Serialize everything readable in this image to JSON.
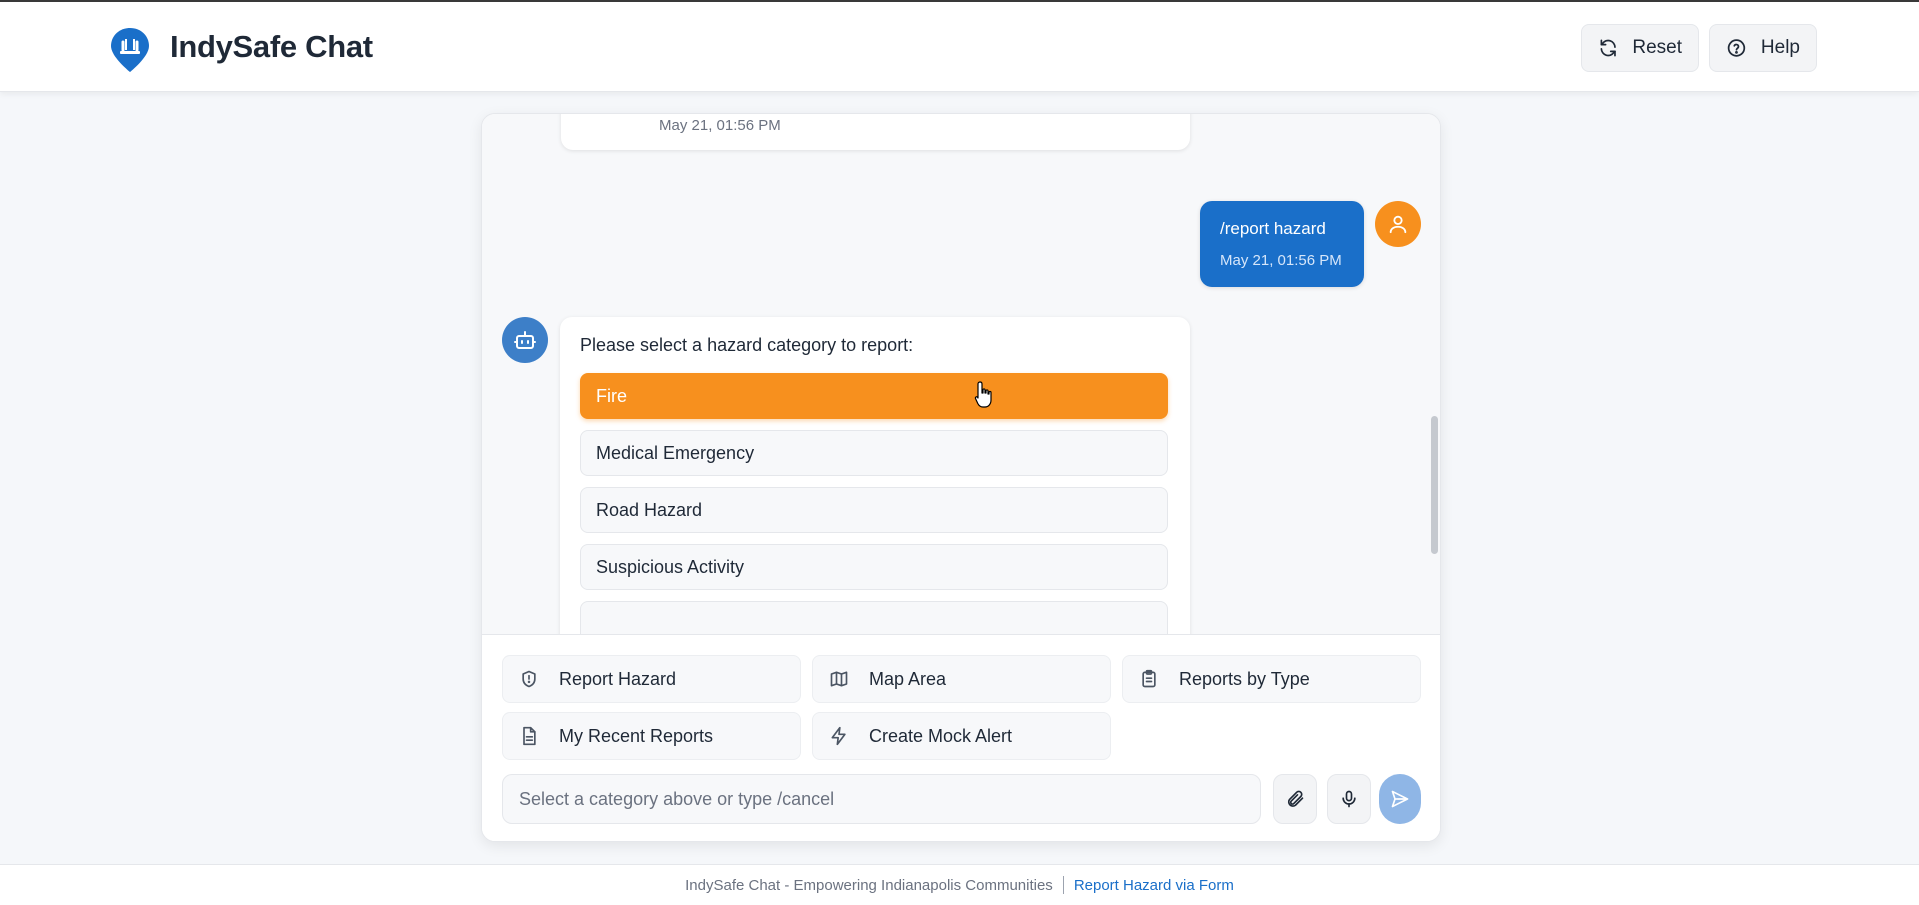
{
  "header": {
    "title": "IndySafe Chat",
    "reset_label": "Reset",
    "help_label": "Help"
  },
  "messages": {
    "previous_timestamp": "May 21, 01:56 PM",
    "user": {
      "text": "/report hazard",
      "timestamp": "May 21, 01:56 PM"
    },
    "bot": {
      "prompt": "Please select a hazard category to report:",
      "options": [
        "Fire",
        "Medical Emergency",
        "Road Hazard",
        "Suspicious Activity"
      ],
      "selected": "Fire"
    }
  },
  "quick_actions": [
    {
      "label": "Report Hazard",
      "icon": "shield-icon"
    },
    {
      "label": "Map Area",
      "icon": "map-icon"
    },
    {
      "label": "Reports by Type",
      "icon": "clipboard-icon"
    },
    {
      "label": "My Recent Reports",
      "icon": "document-icon"
    },
    {
      "label": "Create Mock Alert",
      "icon": "lightning-icon"
    }
  ],
  "input": {
    "placeholder": "Select a category above or type /cancel",
    "value": ""
  },
  "footer": {
    "text": "IndySafe Chat - Empowering Indianapolis Communities",
    "link_label": "Report Hazard via Form"
  },
  "colors": {
    "primary": "#1a6fc9",
    "accent": "#f7901e",
    "bot_avatar": "#3d7fc8",
    "send_button": "#8fb6e6"
  }
}
